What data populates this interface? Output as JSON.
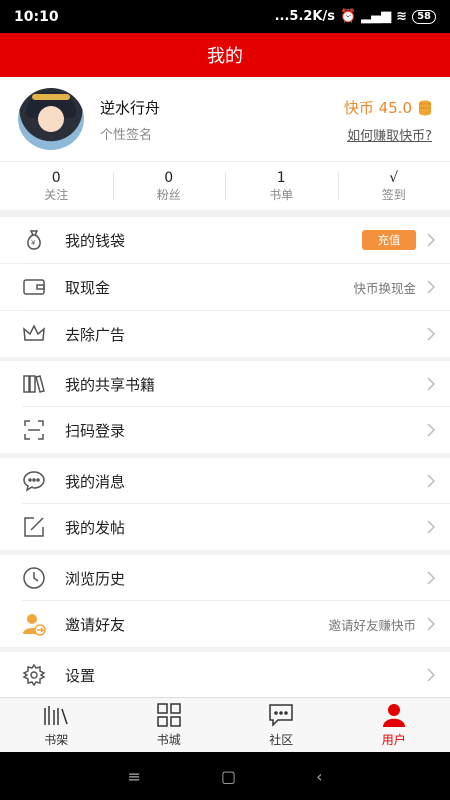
{
  "status": {
    "time": "10:10",
    "speed": "...5.2K/s",
    "battery": "58"
  },
  "header": {
    "title": "我的"
  },
  "profile": {
    "nickname": "逆水行舟",
    "signature": "个性签名",
    "coins_label": "快币 45.0",
    "earn_link": "如何赚取快币?"
  },
  "stats": [
    {
      "value": "0",
      "label": "关注"
    },
    {
      "value": "0",
      "label": "粉丝"
    },
    {
      "value": "1",
      "label": "书单"
    },
    {
      "value": "√",
      "label": "签到"
    }
  ],
  "menu": {
    "wallet": {
      "label": "我的钱袋",
      "action": "充值"
    },
    "cash": {
      "label": "取现金",
      "hint": "快币换现金"
    },
    "ads": {
      "label": "去除广告"
    },
    "shared_books": {
      "label": "我的共享书籍"
    },
    "scan_login": {
      "label": "扫码登录"
    },
    "messages": {
      "label": "我的消息"
    },
    "posts": {
      "label": "我的发帖"
    },
    "history": {
      "label": "浏览历史"
    },
    "invite": {
      "label": "邀请好友",
      "hint": "邀请好友赚快币"
    },
    "settings": {
      "label": "设置"
    }
  },
  "bottom_nav": [
    {
      "label": "书架",
      "icon": "bookshelf-icon"
    },
    {
      "label": "书城",
      "icon": "grid-icon"
    },
    {
      "label": "社区",
      "icon": "chat-icon"
    },
    {
      "label": "用户",
      "icon": "user-icon"
    }
  ],
  "colors": {
    "brand": "#e50000",
    "coin": "#e88a2c",
    "recharge": "#f3913c"
  }
}
